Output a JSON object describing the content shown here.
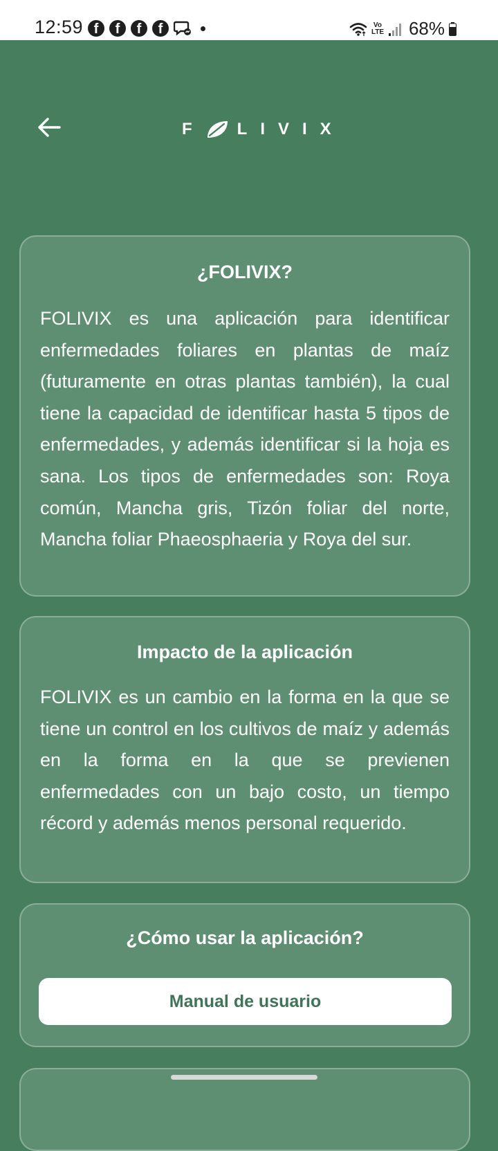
{
  "status_bar": {
    "time": "12:59",
    "notification_icons": [
      "facebook-icon",
      "facebook-icon",
      "facebook-icon",
      "facebook-icon",
      "messenger-icon"
    ],
    "volte_line1": "Vo",
    "volte_line2": "LTE",
    "battery": "68%"
  },
  "header": {
    "brand_first": "F",
    "brand_rest": "LIVIX"
  },
  "about_card": {
    "title": "¿FOLIVIX?",
    "body": "FOLIVIX es una aplicación para identificar enfermedades foliares en plantas de maíz (futuramente en otras plantas también), la cual tiene la capacidad de identificar hasta 5 tipos de enfermedades, y además identificar si la hoja es sana. Los tipos de enfermedades son: Roya común, Mancha gris, Tizón foliar del norte, Mancha foliar Phaeosphaeria y Roya del sur."
  },
  "impact_card": {
    "title": "Impacto de la aplicación",
    "body": "FOLIVIX es un cambio en la forma en la que se tiene un control en los cultivos de maíz y además en la forma en la que se previenen enfermedades con un bajo costo, un tiempo récord y además menos personal requerido."
  },
  "howto_card": {
    "title": "¿Cómo usar la aplicación?",
    "button_label": "Manual de usuario"
  },
  "colors": {
    "background": "#477f5e",
    "button_text": "#3f7556",
    "status_bar": "#ffffff"
  }
}
